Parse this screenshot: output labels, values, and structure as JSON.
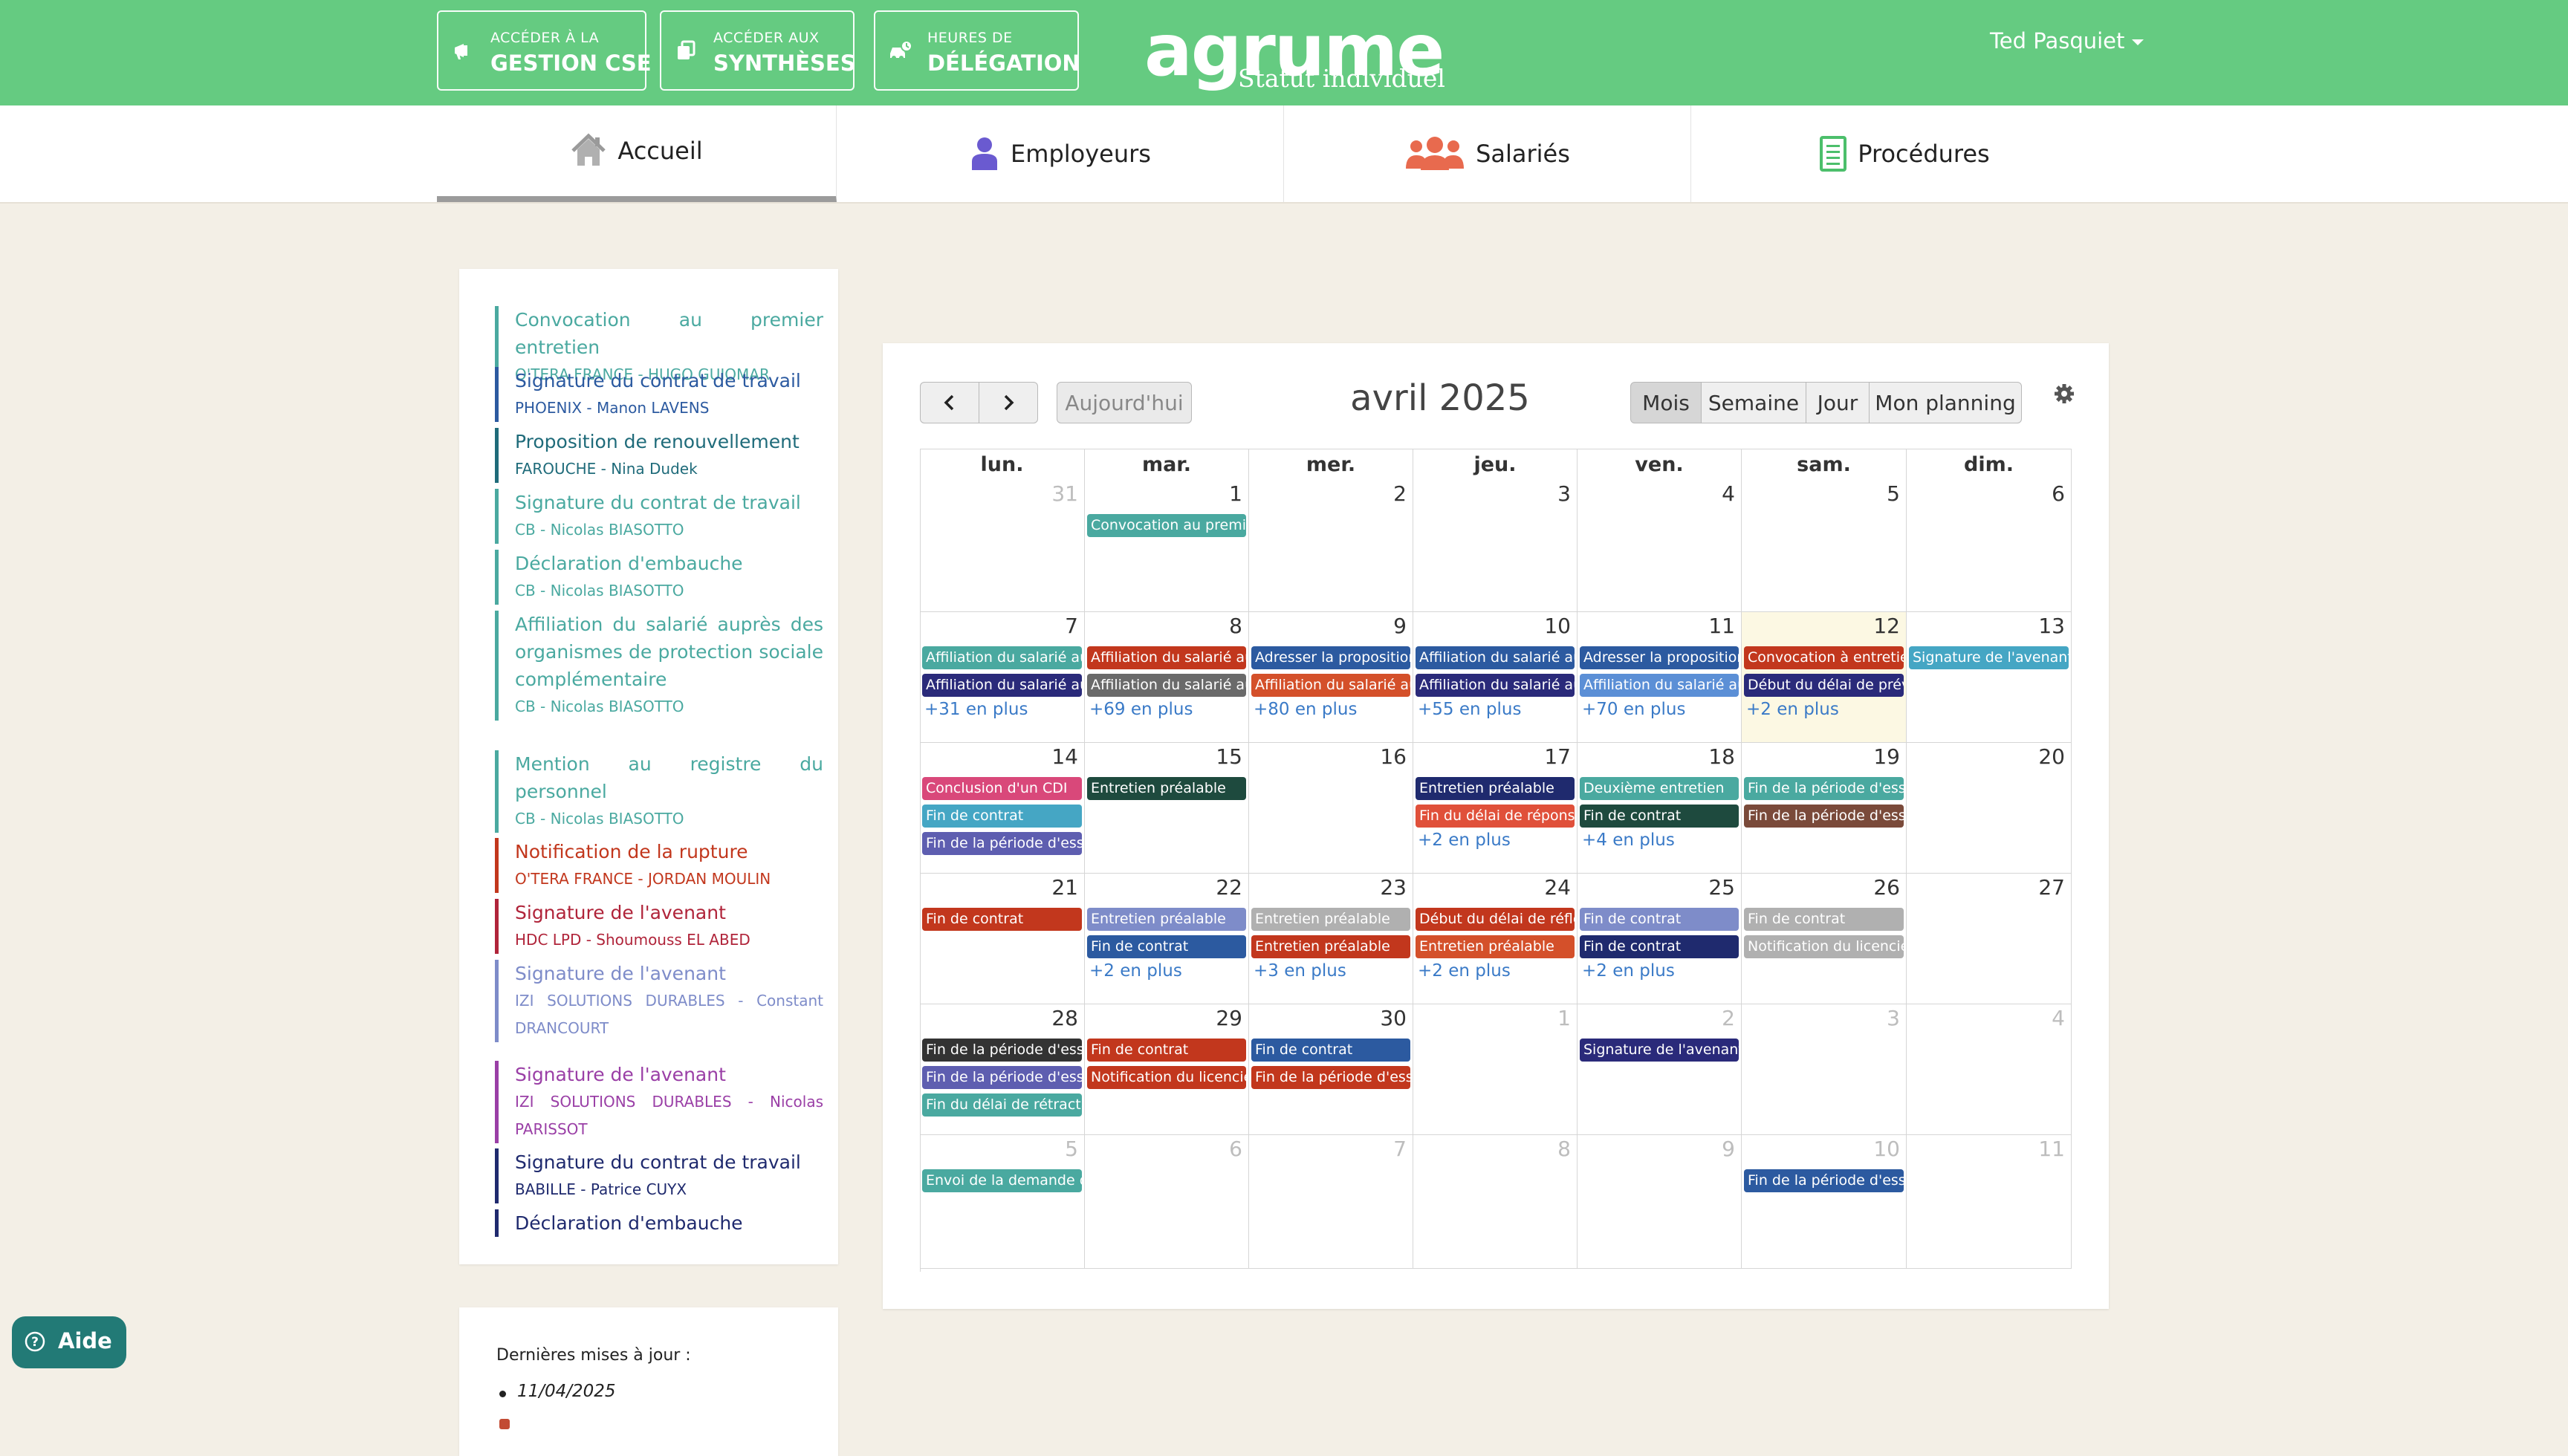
{
  "topbar": {
    "buttons": [
      {
        "small": "ACCÉDER À LA",
        "big": "GESTION CSE",
        "icon": "megaphone-icon"
      },
      {
        "small": "ACCÉDER AUX",
        "big": "SYNTHÈSES",
        "icon": "copy-icon"
      },
      {
        "small": "HEURES DE",
        "big": "DÉLÉGATION",
        "icon": "car-clock-icon"
      }
    ],
    "logo": {
      "word": "agrume",
      "subtitle": "Statut individuel"
    },
    "user": "Ted Pasquiet"
  },
  "nav": {
    "tabs": [
      {
        "label": "Accueil",
        "icon": "home-icon"
      },
      {
        "label": "Employeurs",
        "icon": "person-icon"
      },
      {
        "label": "Salariés",
        "icon": "users-icon"
      },
      {
        "label": "Procédures",
        "icon": "document-icon"
      }
    ]
  },
  "tasks": [
    {
      "title": "Convocation au premier entretien",
      "sub": "O'TERA FRANCE - HUGO GUIOMAR",
      "color": "#4aa9a0"
    },
    {
      "title": "Signature du contrat de travail",
      "sub": "PHOENIX - Manon LAVENS",
      "color": "#2c5aa0"
    },
    {
      "title": "Proposition de renouvellement",
      "sub": "FAROUCHE - Nina Dudek",
      "color": "#1f6b7a"
    },
    {
      "title": "Signature du contrat de travail",
      "sub": "CB - Nicolas BIASOTTO",
      "color": "#4aa9a0"
    },
    {
      "title": "Déclaration d'embauche",
      "sub": "CB - Nicolas BIASOTTO",
      "color": "#4aa9a0"
    },
    {
      "title": "Affiliation du salarié auprès des organismes de protection sociale complémentaire",
      "sub": "CB - Nicolas BIASOTTO",
      "color": "#4aa9a0"
    },
    {
      "title": "Mention au registre du personnel",
      "sub": "CB - Nicolas BIASOTTO",
      "color": "#4aa9a0"
    },
    {
      "title": "Notification de la rupture",
      "sub": "O'TERA FRANCE - JORDAN MOULIN",
      "color": "#c2371d"
    },
    {
      "title": "Signature de l'avenant",
      "sub": "HDC LPD - Shoumouss EL ABED",
      "color": "#b0243a"
    },
    {
      "title": "Signature de l'avenant",
      "sub": "IZI SOLUTIONS DURABLES - Constant DRANCOURT",
      "color": "#7e8cc9"
    },
    {
      "title": "Signature de l'avenant",
      "sub": "IZI SOLUTIONS DURABLES - Nicolas PARISSOT",
      "color": "#9a3fa6"
    },
    {
      "title": "Signature du contrat de travail",
      "sub": "BABILLE - Patrice CUYX",
      "color": "#1f2a6e"
    },
    {
      "title": "Déclaration d'embauche",
      "sub": "",
      "color": "#1f2a6e"
    }
  ],
  "updates": {
    "title": "Dernières mises à jour :",
    "date": "11/04/2025"
  },
  "help": {
    "label": "Aide"
  },
  "calendar": {
    "title": "avril 2025",
    "today_label": "Aujourd'hui",
    "prev_icon": "chevron-left-icon",
    "next_icon": "chevron-right-icon",
    "views": [
      "Mois",
      "Semaine",
      "Jour",
      "Mon planning"
    ],
    "active_view": "Mois",
    "weekdays": [
      "lun.",
      "mar.",
      "mer.",
      "jeu.",
      "ven.",
      "sam.",
      "dim."
    ],
    "weeks": [
      [
        {
          "day": "31",
          "other": true,
          "events": [],
          "more": ""
        },
        {
          "day": "1",
          "events": [
            {
              "t": "Convocation au premier entretien",
              "c": "#4aa9a0"
            }
          ],
          "more": ""
        },
        {
          "day": "2",
          "events": [],
          "more": ""
        },
        {
          "day": "3",
          "events": [],
          "more": ""
        },
        {
          "day": "4",
          "events": [],
          "more": ""
        },
        {
          "day": "5",
          "events": [],
          "more": ""
        },
        {
          "day": "6",
          "events": [],
          "more": ""
        }
      ],
      [
        {
          "day": "7",
          "events": [
            {
              "t": "Affiliation du salarié auprès",
              "c": "#4aa9a0"
            },
            {
              "t": "Affiliation du salarié auprès",
              "c": "#2a2a7a"
            }
          ],
          "more": "+31 en plus"
        },
        {
          "day": "8",
          "events": [
            {
              "t": "Affiliation du salarié auprès",
              "c": "#c2371d"
            },
            {
              "t": "Affiliation du salarié auprès",
              "c": "#6a6a6a"
            }
          ],
          "more": "+69 en plus"
        },
        {
          "day": "9",
          "events": [
            {
              "t": "Adresser la proposition",
              "c": "#2c5aa0"
            },
            {
              "t": "Affiliation du salarié auprès",
              "c": "#d4502a"
            }
          ],
          "more": "+80 en plus"
        },
        {
          "day": "10",
          "events": [
            {
              "t": "Affiliation du salarié auprès",
              "c": "#2c5aa0"
            },
            {
              "t": "Affiliation du salarié auprès",
              "c": "#2a2a7a"
            }
          ],
          "more": "+55 en plus"
        },
        {
          "day": "11",
          "events": [
            {
              "t": "Adresser la proposition",
              "c": "#2c5aa0"
            },
            {
              "t": "Affiliation du salarié auprès",
              "c": "#5b8fd6"
            }
          ],
          "more": "+70 en plus"
        },
        {
          "day": "12",
          "today": true,
          "events": [
            {
              "t": "Convocation à entretien",
              "c": "#c2371d"
            },
            {
              "t": "Début du délai de prévenance",
              "c": "#2a2a7a"
            }
          ],
          "more": "+2 en plus"
        },
        {
          "day": "13",
          "events": [
            {
              "t": "Signature de l'avenant",
              "c": "#45a6c4"
            }
          ],
          "more": ""
        }
      ],
      [
        {
          "day": "14",
          "events": [
            {
              "t": "Conclusion d'un CDI",
              "c": "#d9487a"
            },
            {
              "t": "Fin de contrat",
              "c": "#45a6c4"
            },
            {
              "t": "Fin de la période d'essai",
              "c": "#5e5eb0"
            }
          ],
          "more": ""
        },
        {
          "day": "15",
          "events": [
            {
              "t": "Entretien préalable",
              "c": "#1e4a3e"
            }
          ],
          "more": ""
        },
        {
          "day": "16",
          "events": [],
          "more": ""
        },
        {
          "day": "17",
          "events": [
            {
              "t": "Entretien préalable",
              "c": "#1f2a6e"
            },
            {
              "t": "Fin du délai de réponse",
              "c": "#e0503a"
            }
          ],
          "more": "+2 en plus"
        },
        {
          "day": "18",
          "events": [
            {
              "t": "Deuxième entretien",
              "c": "#4aa9a0"
            },
            {
              "t": "Fin de contrat",
              "c": "#1e4a3e"
            }
          ],
          "more": "+4 en plus"
        },
        {
          "day": "19",
          "events": [
            {
              "t": "Fin de la période d'essai",
              "c": "#4aa9a0"
            },
            {
              "t": "Fin de la période d'essai",
              "c": "#7a4a3a"
            }
          ],
          "more": ""
        },
        {
          "day": "20",
          "events": [],
          "more": ""
        }
      ],
      [
        {
          "day": "21",
          "events": [
            {
              "t": "Fin de contrat",
              "c": "#c2371d"
            }
          ],
          "more": ""
        },
        {
          "day": "22",
          "events": [
            {
              "t": "Entretien préalable",
              "c": "#7e8cc9"
            },
            {
              "t": "Fin de contrat",
              "c": "#2c5aa0"
            }
          ],
          "more": "+2 en plus"
        },
        {
          "day": "23",
          "events": [
            {
              "t": "Entretien préalable",
              "c": "#b0b0b0"
            },
            {
              "t": "Entretien préalable",
              "c": "#c2371d"
            }
          ],
          "more": "+3 en plus"
        },
        {
          "day": "24",
          "events": [
            {
              "t": "Début du délai de réflexion",
              "c": "#c2371d"
            },
            {
              "t": "Entretien préalable",
              "c": "#d4502a"
            }
          ],
          "more": "+2 en plus"
        },
        {
          "day": "25",
          "events": [
            {
              "t": "Fin de contrat",
              "c": "#7e8cc9"
            },
            {
              "t": "Fin de contrat",
              "c": "#1f2a6e"
            }
          ],
          "more": "+2 en plus"
        },
        {
          "day": "26",
          "events": [
            {
              "t": "Fin de contrat",
              "c": "#b0b0b0"
            },
            {
              "t": "Notification du licenciement",
              "c": "#b0b0b0"
            }
          ],
          "more": ""
        },
        {
          "day": "27",
          "events": [],
          "more": ""
        }
      ],
      [
        {
          "day": "28",
          "events": [
            {
              "t": "Fin de la période d'essai",
              "c": "#333333"
            },
            {
              "t": "Fin de la période d'essai",
              "c": "#5e5eb0"
            },
            {
              "t": "Fin du délai de rétractation",
              "c": "#4aa9a0"
            }
          ],
          "more": ""
        },
        {
          "day": "29",
          "events": [
            {
              "t": "Fin de contrat",
              "c": "#c2371d"
            },
            {
              "t": "Notification du licenciement",
              "c": "#c2371d"
            }
          ],
          "more": ""
        },
        {
          "day": "30",
          "events": [
            {
              "t": "Fin de contrat",
              "c": "#2c5aa0"
            },
            {
              "t": "Fin de la période d'essai",
              "c": "#c2371d"
            }
          ],
          "more": ""
        },
        {
          "day": "1",
          "other": true,
          "events": [],
          "more": ""
        },
        {
          "day": "2",
          "other": true,
          "events": [
            {
              "t": "Signature de l'avenant",
              "c": "#2a2a7a"
            }
          ],
          "more": ""
        },
        {
          "day": "3",
          "other": true,
          "events": [],
          "more": ""
        },
        {
          "day": "4",
          "other": true,
          "events": [],
          "more": ""
        }
      ],
      [
        {
          "day": "5",
          "other": true,
          "events": [
            {
              "t": "Envoi de la demande d'homologation",
              "c": "#4aa9a0"
            }
          ],
          "more": ""
        },
        {
          "day": "6",
          "other": true,
          "events": [],
          "more": ""
        },
        {
          "day": "7",
          "other": true,
          "events": [],
          "more": ""
        },
        {
          "day": "8",
          "other": true,
          "events": [],
          "more": ""
        },
        {
          "day": "9",
          "other": true,
          "events": [],
          "more": ""
        },
        {
          "day": "10",
          "other": true,
          "events": [
            {
              "t": "Fin de la période d'essai",
              "c": "#2c5aa0"
            }
          ],
          "more": ""
        },
        {
          "day": "11",
          "other": true,
          "events": [],
          "more": ""
        }
      ]
    ]
  }
}
